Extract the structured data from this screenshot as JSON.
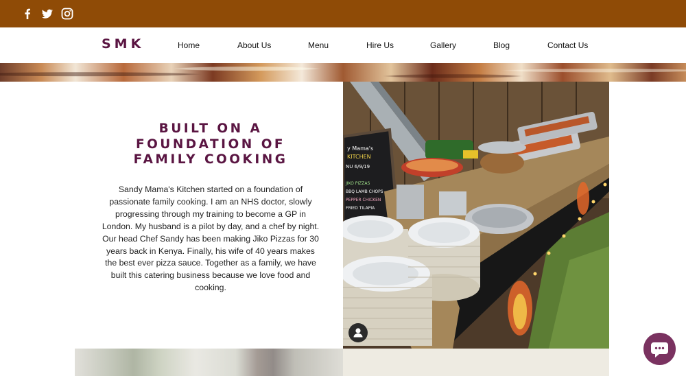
{
  "header": {
    "social": [
      {
        "icon": "facebook-icon"
      },
      {
        "icon": "twitter-icon"
      },
      {
        "icon": "instagram-icon"
      }
    ],
    "logo": "SMK",
    "nav": [
      "Home",
      "About Us",
      "Menu",
      "Hire Us",
      "Gallery",
      "Blog",
      "Contact Us"
    ]
  },
  "about": {
    "heading": [
      "BUILT ON A",
      "FOUNDATION OF",
      "FAMILY COOKING"
    ],
    "body": "Sandy Mama's Kitchen started on a foundation of passionate family cooking. I am an NHS doctor, slowly progressing through my training to become a GP in London. My husband is a pilot by day, and a chef by night. Our head Chef Sandy has been making Jiko Pizzas for 30 years back in Kenya. Finally, his wife of 40 years makes the best ever pizza sauce. Together as a family, we have built this catering business because we love food and cooking."
  },
  "photo": {
    "chalkboard": [
      "y Mama's",
      "KITCHEN",
      "NU 6/9/19",
      "JIKO PIZZAS",
      "BBQ LAMB CHOPS",
      "PEPPER CHICKEN",
      "FRIED TILAPIA"
    ]
  },
  "colors": {
    "topbar": "#8f4b06",
    "brand": "#5a1542",
    "chat": "#7a3260"
  },
  "widgets": {
    "profile_icon": "user-icon",
    "chat_icon": "chat-bubble-icon"
  }
}
